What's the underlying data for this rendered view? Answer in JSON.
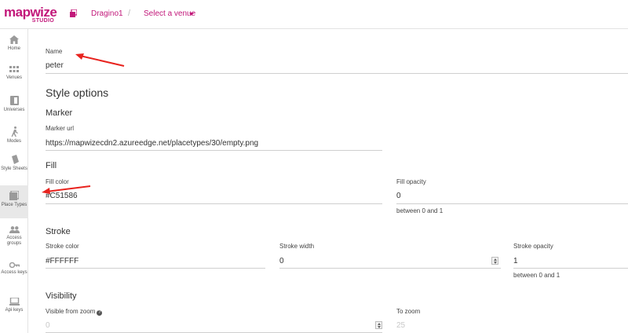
{
  "app": {
    "logo_text": "mapwize",
    "logo_sub": "STUDIO",
    "organization": "Dragino1",
    "separator": "/",
    "venue_select": "Select a venue",
    "accent_color": "#c2187a"
  },
  "sidebar": {
    "items": [
      {
        "label": "Home",
        "icon": "home-icon"
      },
      {
        "label": "Venues",
        "icon": "grid-icon"
      },
      {
        "label": "Universes",
        "icon": "book-icon"
      },
      {
        "label": "Modes",
        "icon": "walk-icon"
      },
      {
        "label": "Style Sheets",
        "icon": "palette-icon"
      },
      {
        "label": "Place Types",
        "icon": "place-types-icon",
        "active": true
      },
      {
        "label": "Access groups",
        "icon": "groups-icon"
      },
      {
        "label": "Access keys",
        "icon": "key-icon"
      },
      {
        "label": "Api keys",
        "icon": "laptop-icon"
      }
    ]
  },
  "form": {
    "name_label": "Name",
    "name_value": "peter",
    "style_options_title": "Style options",
    "marker": {
      "title": "Marker",
      "url_label": "Marker url",
      "url_value": "https://mapwizecdn2.azureedge.net/placetypes/30/empty.png"
    },
    "fill": {
      "title": "Fill",
      "color_label": "Fill color",
      "color_value": "#C51586",
      "opacity_label": "Fill opacity",
      "opacity_value": "0",
      "opacity_helper": "between 0 and 1"
    },
    "stroke": {
      "title": "Stroke",
      "color_label": "Stroke color",
      "color_value": "#FFFFFF",
      "width_label": "Stroke width",
      "width_value": "0",
      "opacity_label": "Stroke opacity",
      "opacity_value": "1",
      "opacity_helper": "between 0 and 1"
    },
    "visibility": {
      "title": "Visibility",
      "from_zoom_label": "Visible from zoom",
      "from_zoom_value": "0",
      "to_zoom_label": "To zoom",
      "to_zoom_value": "25"
    }
  }
}
